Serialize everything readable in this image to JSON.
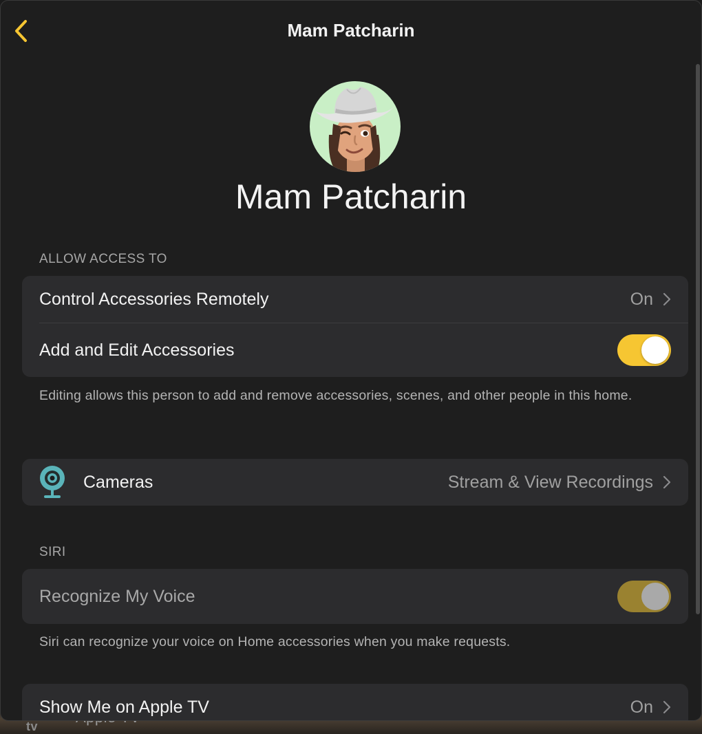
{
  "navbar": {
    "title": "Mam Patcharin",
    "back_icon": "chevron-left-icon"
  },
  "profile": {
    "name": "Mam Patcharin",
    "avatar_icon": "memoji-avatar",
    "avatar_bg": "#c9efc6"
  },
  "access": {
    "header": "ALLOW ACCESS TO",
    "remote": {
      "label": "Control Accessories Remotely",
      "value": "On"
    },
    "edit": {
      "label": "Add and Edit Accessories",
      "toggle": "on"
    },
    "footnote": "Editing allows this person to add and remove accessories, scenes, and other people in this home."
  },
  "cameras": {
    "icon": "camera-icon",
    "label": "Cameras",
    "value": "Stream & View Recordings"
  },
  "siri": {
    "header": "SIRI",
    "recognize": {
      "label": "Recognize My Voice",
      "toggle": "on-disabled"
    },
    "footnote": "Siri can recognize your voice on Home accessories when you make requests."
  },
  "appletv": {
    "label": "Show Me on Apple TV",
    "value": "On"
  },
  "background": {
    "tv_logo": "tv",
    "tv_name": "Apple TV"
  },
  "colors": {
    "accent": "#f6c632",
    "sheet_bg": "#1e1e1e",
    "group_bg": "#2c2c2e",
    "camera_icon": "#5ab4b9"
  }
}
